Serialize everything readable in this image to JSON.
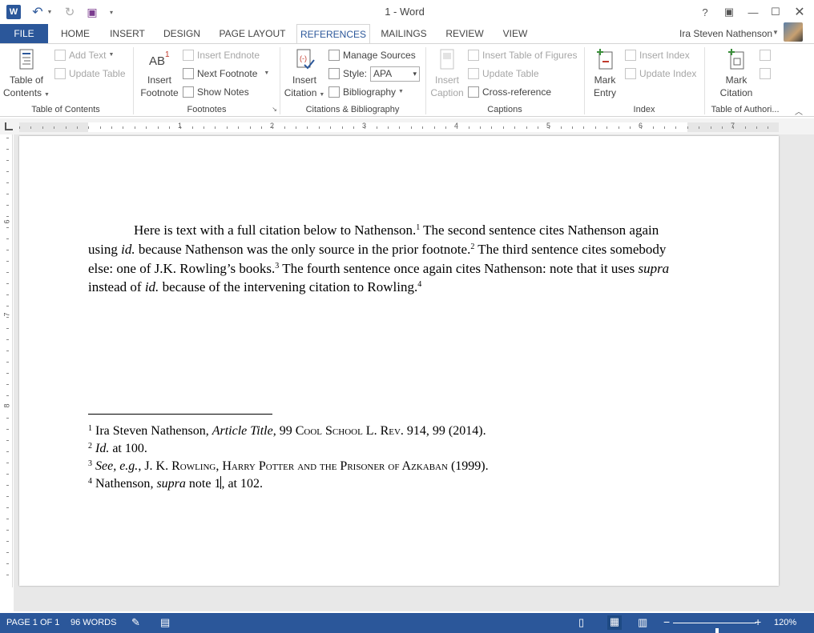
{
  "app": {
    "title": "1 - Word",
    "logo": "W"
  },
  "quick_access": {
    "undo_icon": "undo-icon",
    "redo_icon": "redo-icon",
    "save_icon": "save-icon"
  },
  "window_controls": {
    "help": "?",
    "restore_ribbon": "▣",
    "minimize": "—",
    "maximize": "☐",
    "close": "✕"
  },
  "tabs": [
    "FILE",
    "HOME",
    "INSERT",
    "DESIGN",
    "PAGE LAYOUT",
    "REFERENCES",
    "MAILINGS",
    "REVIEW",
    "VIEW"
  ],
  "active_tab": "REFERENCES",
  "user": {
    "name": "Ira Steven Nathenson"
  },
  "ribbon": {
    "toc": {
      "label": "Table of Contents",
      "big": [
        "Table of",
        "Contents"
      ],
      "add_text": "Add Text",
      "update_table": "Update Table"
    },
    "footnotes": {
      "label": "Footnotes",
      "insert_footnote": [
        "Insert",
        "Footnote"
      ],
      "insert_endnote": "Insert Endnote",
      "next_footnote": "Next Footnote",
      "show_notes": "Show Notes"
    },
    "citations": {
      "label": "Citations & Bibliography",
      "insert_citation": [
        "Insert",
        "Citation"
      ],
      "manage_sources": "Manage Sources",
      "style_label": "Style:",
      "style_value": "APA",
      "bibliography": "Bibliography"
    },
    "captions": {
      "label": "Captions",
      "insert_caption": [
        "Insert",
        "Caption"
      ],
      "insert_tof": "Insert Table of Figures",
      "update_table": "Update Table",
      "cross_reference": "Cross-reference"
    },
    "index": {
      "label": "Index",
      "mark_entry": [
        "Mark",
        "Entry"
      ],
      "insert_index": "Insert Index",
      "update_index": "Update Index"
    },
    "toa": {
      "label": "Table of Authori...",
      "mark_citation": [
        "Mark",
        "Citation"
      ]
    }
  },
  "ruler": {
    "h_numbers": [
      "1",
      "2",
      "3",
      "4",
      "5",
      "6",
      "7"
    ],
    "v_numbers": [
      "6",
      "7",
      "8"
    ]
  },
  "document": {
    "p": [
      "Here is text with a full citation below to Nathenson.",
      "1",
      "  The second sentence cites Nathenson again using ",
      "id.",
      " because Nathenson was the only source in the prior footnote.",
      "2",
      "  The third sentence cites somebody else: one of J.K. Rowling’s books.",
      "3",
      "  The fourth sentence once again cites Nathenson: note that it uses ",
      "supra",
      " instead of ",
      "id.",
      " because of the intervening citation to Rowling.",
      "4"
    ],
    "footnotes": [
      {
        "n": "1",
        "a": " Ira Steven Nathenson, ",
        "b": "Article Title",
        "c": ", 99 ",
        "d": "Cool School L. Rev.",
        "e": " 914, 99 (2014)."
      },
      {
        "n": "2",
        "a": " ",
        "b": "Id.",
        "c": " at 100."
      },
      {
        "n": "3",
        "a": " ",
        "b": "See, e.g.",
        "c": ", J. K. ",
        "d": "Rowling, Harry Potter and the Prisoner of Azkaban",
        "e": " (1999)."
      },
      {
        "n": "4",
        "a": " Nathenson",
        "b": ", supra",
        "c": " note 1",
        "d": ", at 102."
      }
    ]
  },
  "status": {
    "page": "PAGE 1 OF 1",
    "words": "96 WORDS",
    "zoom": "120%",
    "zoom_percent": 120
  }
}
